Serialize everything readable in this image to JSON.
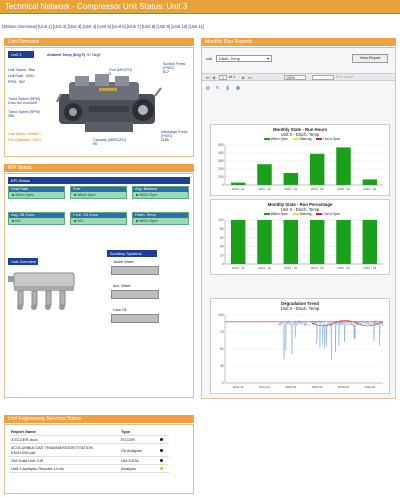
{
  "header": {
    "title": "Technical Network - Compressor Unit Status: Unit 3"
  },
  "unit_nav": "[Station Overview] [Unit 1] [Unit 2] [Unit 3] [Unit 4] [Unit 5] [Unit 6] [Unit 7] [Unit 8] [Unit 9] [Unit 10] [Unit 11]",
  "unit_overview": {
    "title": "Unit Overview",
    "unit_badge": "Unit 3",
    "ambient_label": "Ambient Temp (Deg F)",
    "ambient_value": "57 DegF",
    "unit_status_label": "Unit Status:",
    "unit_status_value": "Run",
    "unit_rate_label": "Unit Rate:",
    "unit_rate_value": "0001",
    "rpm_label": "RPM:",
    "rpm_value": "907",
    "fuel_label": "Fuel (MSCFD)",
    "fuel_value": "0",
    "suction_label": "Suction Press (PSIG)",
    "suction_value": "617",
    "turbo_label": "Turbo Speed (RPM)",
    "turbo_sub": "Data Not Available",
    "turbo_b_label": "Turbo Speed (RPM)",
    "turbo_b_value": "255",
    "gas_detect": "Gas Detect:  Inhibit 0",
    "fire_detect": "Fire Detection:  100.0",
    "capacity_label": "Capacity (MMSCFD)",
    "capacity_value": "95",
    "discharge_label": "Discharge Press (PSIG)",
    "discharge_value": "1189"
  },
  "kpi": {
    "title": "KPI Status",
    "head": "KPI Status",
    "boxes": [
      {
        "title": "Heat Rate",
        "status": "Within Spec"
      },
      {
        "title": "Fuel",
        "status": "Within Spec"
      },
      {
        "title": "Avg. Balance",
        "status": "Within Spec"
      },
      {
        "title": "Avg. Oil Cons.",
        "status": "N/A"
      },
      {
        "title": "Crnk. Oil Cons.",
        "status": "N/A"
      },
      {
        "title": "Disch. Temp",
        "status": "Within Spec"
      }
    ],
    "unit_overview_label": "Unit Overview",
    "aux_head": "Auxiliary Systems",
    "aux": [
      "Jacket Water",
      "Aux. Water",
      "Lube Oil"
    ]
  },
  "monthly": {
    "title": "Monthly Run Reports",
    "toolbar": {
      "unit_label": "unit",
      "select_value": "Disch. Temp",
      "view_report": "View Report",
      "page_current": "1",
      "page_total": "of 1",
      "zoom": "100%",
      "find": "Find | Next"
    }
  },
  "chart_hours": {
    "type": "bar",
    "title": "Monthly State - Run Hours",
    "subtitle": "Unit 3 - Disch. Temp",
    "legend": [
      "Within Spec",
      "Warning",
      "Out of Spec"
    ],
    "categories": [
      "2014 - 11",
      "2014 - 12",
      "2015 - 01",
      "2015 - 02",
      "2015 - 03",
      "2015 - 04"
    ],
    "values": [
      30,
      260,
      150,
      390,
      470,
      70
    ],
    "ylim": [
      0,
      500
    ],
    "yticks": [
      "0",
      "100",
      "200",
      "300",
      "400",
      "500"
    ]
  },
  "chart_pct": {
    "type": "bar",
    "title": "Monthly State - Run Percentage",
    "subtitle": "Unit 3 - Disch. Temp",
    "legend": [
      "Within Spec",
      "Warning",
      "Out of Spec"
    ],
    "categories": [
      "2014 - 11",
      "2014 - 12",
      "2015 - 01",
      "2015 - 02",
      "2015 - 03",
      "2015 - 04"
    ],
    "values": [
      100,
      100,
      100,
      100,
      100,
      100
    ],
    "ylim": [
      0,
      100
    ],
    "yticks": [
      "0",
      "20",
      "40",
      "60",
      "80",
      "100"
    ]
  },
  "chart_trend": {
    "type": "line",
    "title": "Degradation Trend",
    "subtitle": "Unit 3 - Disch. Temp",
    "legend": [
      "Within Spec",
      "Warning",
      "Out of Spec"
    ],
    "yticks": [
      "0",
      "25",
      "50",
      "75",
      "100"
    ],
    "xticks": [
      "2014-11",
      "2014-12",
      "2015-01",
      "2015-02",
      "2015-03",
      "2015-04"
    ]
  },
  "engineering": {
    "title": "Unit Engineering Services Status",
    "col_name": "Report Name",
    "col_type": "Type",
    "rows": [
      {
        "name": "3 ECCER.docx",
        "type": "ECCER",
        "color": "#111111"
      },
      {
        "name": "3COLUMBIA GAS TRANSMISSION STATION ENGLISH.pdf",
        "type": "Oil Analysis",
        "color": "#111111"
      },
      {
        "name": "OM Data Unit 3.tif",
        "type": "OM DATA",
        "color": "#111111"
      },
      {
        "name": "Unit 3 Analysis Reports 14.xls",
        "type": "Analysis",
        "color": "#d8c000"
      }
    ]
  },
  "colors": {
    "accent": "#f0a040",
    "navy": "#1d3f9a",
    "green": "#1aa01a",
    "warning": "#f0e030",
    "out": "#e02020"
  }
}
